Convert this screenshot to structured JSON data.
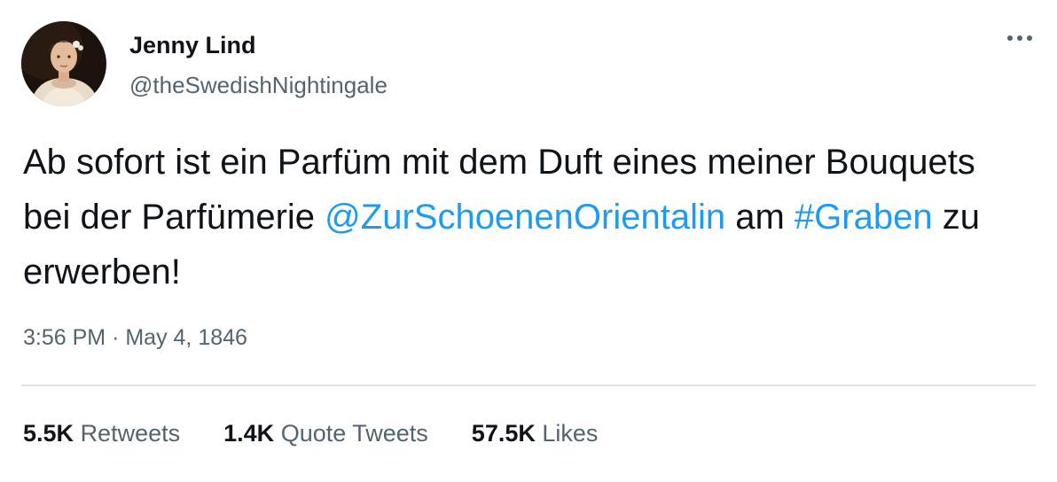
{
  "author": {
    "name": "Jenny Lind",
    "handle": "@theSwedishNightingale"
  },
  "menu": {
    "icon": "more-horizontal-icon"
  },
  "tweet": {
    "text_before_mention": "Ab sofort ist ein Parfüm mit dem Duft eines meiner Bouquets bei der Parfümerie ",
    "mention": "@ZurSchoenenOrientalin",
    "text_between": " am ",
    "hashtag": "#Graben",
    "text_after_hashtag": " zu erwerben!"
  },
  "meta": {
    "time": "3:56 PM",
    "separator": "·",
    "date": "May 4, 1846"
  },
  "stats": [
    {
      "count": "5.5K",
      "label": "Retweets"
    },
    {
      "count": "1.4K",
      "label": "Quote Tweets"
    },
    {
      "count": "57.5K",
      "label": "Likes"
    }
  ],
  "colors": {
    "text": "#0f1419",
    "secondary": "#536471",
    "link": "#1d9bf0",
    "divider": "#dfe3e6"
  }
}
